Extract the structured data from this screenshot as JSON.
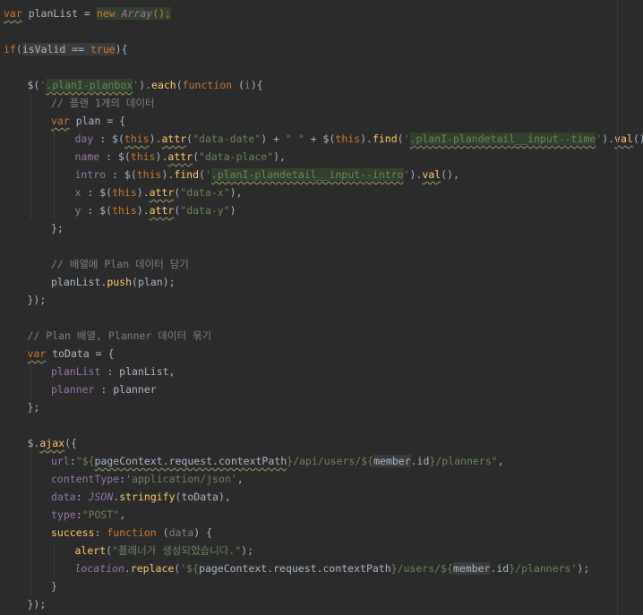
{
  "editor": {
    "lines": [
      {
        "n": 1,
        "indent": 0,
        "tokens": [
          {
            "t": "var",
            "c": "kw sq"
          },
          {
            "t": " planList = ",
            "c": "plain"
          },
          {
            "t": "new ",
            "c": "kw hl"
          },
          {
            "t": "Array",
            "c": "prop it hl"
          },
          {
            "t": "();",
            "c": "kw hl"
          }
        ]
      },
      {
        "n": 2,
        "indent": 0,
        "tokens": []
      },
      {
        "n": 3,
        "indent": 0,
        "tokens": [
          {
            "t": "if",
            "c": "kw"
          },
          {
            "t": "(",
            "c": "plain"
          },
          {
            "t": "isValid == ",
            "c": "plain hl2"
          },
          {
            "t": "true",
            "c": "kw hl2"
          },
          {
            "t": "){",
            "c": "plain"
          }
        ]
      },
      {
        "n": 4,
        "indent": 0,
        "tokens": []
      },
      {
        "n": 5,
        "indent": 1,
        "tokens": [
          {
            "t": "$(",
            "c": "plain"
          },
          {
            "t": "'",
            "c": "str"
          },
          {
            "t": ".planI-planbox",
            "c": "str hl sq"
          },
          {
            "t": "'",
            "c": "str"
          },
          {
            "t": ").",
            "c": "plain"
          },
          {
            "t": "each",
            "c": "fn"
          },
          {
            "t": "(",
            "c": "plain"
          },
          {
            "t": "function ",
            "c": "kw"
          },
          {
            "t": "(",
            "c": "plain"
          },
          {
            "t": "i",
            "c": "cmt"
          },
          {
            "t": "){",
            "c": "plain"
          }
        ]
      },
      {
        "n": 6,
        "indent": 2,
        "tokens": [
          {
            "t": "// 플랜 1개의 데이터",
            "c": "cmt"
          }
        ]
      },
      {
        "n": 7,
        "indent": 2,
        "tokens": [
          {
            "t": "var",
            "c": "kw sq"
          },
          {
            "t": " plan = {",
            "c": "plain"
          }
        ]
      },
      {
        "n": 8,
        "indent": 3,
        "tokens": [
          {
            "t": "day",
            "c": "prop"
          },
          {
            "t": " : $(",
            "c": "plain"
          },
          {
            "t": "this",
            "c": "kw sq"
          },
          {
            "t": ").",
            "c": "plain"
          },
          {
            "t": "attr",
            "c": "fn sq"
          },
          {
            "t": "(",
            "c": "plain"
          },
          {
            "t": "\"data-date\"",
            "c": "str"
          },
          {
            "t": ") + ",
            "c": "plain"
          },
          {
            "t": "\" \"",
            "c": "str"
          },
          {
            "t": " + $(",
            "c": "plain"
          },
          {
            "t": "this",
            "c": "kw"
          },
          {
            "t": ").",
            "c": "plain"
          },
          {
            "t": "find",
            "c": "fn"
          },
          {
            "t": "(",
            "c": "plain"
          },
          {
            "t": "'",
            "c": "str"
          },
          {
            "t": ".planI-plandetail__input--time",
            "c": "str hl sq"
          },
          {
            "t": "'",
            "c": "str"
          },
          {
            "t": ").",
            "c": "plain"
          },
          {
            "t": "val",
            "c": "fn sq"
          },
          {
            "t": "(),",
            "c": "plain"
          }
        ]
      },
      {
        "n": 9,
        "indent": 3,
        "tokens": [
          {
            "t": "name",
            "c": "prop"
          },
          {
            "t": " : $(",
            "c": "plain"
          },
          {
            "t": "this",
            "c": "kw"
          },
          {
            "t": ").",
            "c": "plain"
          },
          {
            "t": "attr",
            "c": "fn sq"
          },
          {
            "t": "(",
            "c": "plain"
          },
          {
            "t": "\"data-place\"",
            "c": "str"
          },
          {
            "t": "),",
            "c": "plain"
          }
        ]
      },
      {
        "n": 10,
        "indent": 3,
        "tokens": [
          {
            "t": "intro",
            "c": "prop"
          },
          {
            "t": " : $(",
            "c": "plain"
          },
          {
            "t": "this",
            "c": "kw"
          },
          {
            "t": ").",
            "c": "plain"
          },
          {
            "t": "find",
            "c": "fn"
          },
          {
            "t": "(",
            "c": "plain"
          },
          {
            "t": "'",
            "c": "str"
          },
          {
            "t": ".planI-plandetail__input--intro",
            "c": "str hl sq"
          },
          {
            "t": "'",
            "c": "str"
          },
          {
            "t": ").",
            "c": "plain"
          },
          {
            "t": "val",
            "c": "fn sq"
          },
          {
            "t": "(),",
            "c": "plain"
          }
        ]
      },
      {
        "n": 11,
        "indent": 3,
        "tokens": [
          {
            "t": "x",
            "c": "prop"
          },
          {
            "t": " : $(",
            "c": "plain"
          },
          {
            "t": "this",
            "c": "kw"
          },
          {
            "t": ").",
            "c": "plain"
          },
          {
            "t": "attr",
            "c": "fn sq"
          },
          {
            "t": "(",
            "c": "plain"
          },
          {
            "t": "\"data-x\"",
            "c": "str"
          },
          {
            "t": "),",
            "c": "plain"
          }
        ]
      },
      {
        "n": 12,
        "indent": 3,
        "tokens": [
          {
            "t": "y",
            "c": "prop"
          },
          {
            "t": " : $(",
            "c": "plain"
          },
          {
            "t": "this",
            "c": "kw"
          },
          {
            "t": ").",
            "c": "plain"
          },
          {
            "t": "attr",
            "c": "fn sq"
          },
          {
            "t": "(",
            "c": "plain"
          },
          {
            "t": "\"data-y\"",
            "c": "str"
          },
          {
            "t": ")",
            "c": "plain"
          }
        ]
      },
      {
        "n": 13,
        "indent": 2,
        "tokens": [
          {
            "t": "};",
            "c": "plain"
          }
        ]
      },
      {
        "n": 14,
        "indent": 0,
        "tokens": []
      },
      {
        "n": 15,
        "indent": 2,
        "tokens": [
          {
            "t": "// 배열에 Plan 데이터 담기",
            "c": "cmt"
          }
        ]
      },
      {
        "n": 16,
        "indent": 2,
        "tokens": [
          {
            "t": "planList",
            "c": "plain"
          },
          {
            "t": ".",
            "c": "plain"
          },
          {
            "t": "push",
            "c": "fn"
          },
          {
            "t": "(plan);",
            "c": "plain"
          }
        ]
      },
      {
        "n": 17,
        "indent": 1,
        "tokens": [
          {
            "t": "});",
            "c": "plain"
          }
        ]
      },
      {
        "n": 18,
        "indent": 0,
        "tokens": []
      },
      {
        "n": 19,
        "indent": 1,
        "tokens": [
          {
            "t": "// Plan 배열, Planner 데이터 묶기",
            "c": "cmt"
          }
        ]
      },
      {
        "n": 20,
        "indent": 1,
        "tokens": [
          {
            "t": "var",
            "c": "kw sq"
          },
          {
            "t": " toData = {",
            "c": "plain"
          }
        ]
      },
      {
        "n": 21,
        "indent": 2,
        "tokens": [
          {
            "t": "planList",
            "c": "prop"
          },
          {
            "t": " : planList,",
            "c": "plain"
          }
        ]
      },
      {
        "n": 22,
        "indent": 2,
        "tokens": [
          {
            "t": "planner",
            "c": "prop"
          },
          {
            "t": " : planner",
            "c": "plain"
          }
        ]
      },
      {
        "n": 23,
        "indent": 1,
        "tokens": [
          {
            "t": "};",
            "c": "plain"
          }
        ]
      },
      {
        "n": 24,
        "indent": 0,
        "tokens": []
      },
      {
        "n": 25,
        "indent": 1,
        "tokens": [
          {
            "t": "$.",
            "c": "plain"
          },
          {
            "t": "ajax",
            "c": "fn sq"
          },
          {
            "t": "({",
            "c": "plain"
          }
        ]
      },
      {
        "n": 26,
        "indent": 2,
        "tokens": [
          {
            "t": "url",
            "c": "prop"
          },
          {
            "t": ":",
            "c": "plain"
          },
          {
            "t": "\"${",
            "c": "str"
          },
          {
            "t": "pageContext.request.contextPath",
            "c": "plain sq"
          },
          {
            "t": "}/api/users/${",
            "c": "str"
          },
          {
            "t": "member",
            "c": "plain hl2"
          },
          {
            "t": ".id",
            "c": "plain"
          },
          {
            "t": "}/planners\"",
            "c": "str"
          },
          {
            "t": ",",
            "c": "plain"
          }
        ]
      },
      {
        "n": 27,
        "indent": 2,
        "tokens": [
          {
            "t": "contentType",
            "c": "prop"
          },
          {
            "t": ":",
            "c": "plain"
          },
          {
            "t": "'application/json'",
            "c": "str"
          },
          {
            "t": ",",
            "c": "plain"
          }
        ]
      },
      {
        "n": 28,
        "indent": 2,
        "tokens": [
          {
            "t": "data",
            "c": "prop"
          },
          {
            "t": ": ",
            "c": "plain"
          },
          {
            "t": "JSON",
            "c": "prop it"
          },
          {
            "t": ".",
            "c": "plain"
          },
          {
            "t": "stringify",
            "c": "fn"
          },
          {
            "t": "(toData),",
            "c": "plain"
          }
        ]
      },
      {
        "n": 29,
        "indent": 2,
        "tokens": [
          {
            "t": "type",
            "c": "prop"
          },
          {
            "t": ":",
            "c": "plain"
          },
          {
            "t": "\"POST\"",
            "c": "str"
          },
          {
            "t": ",",
            "c": "plain"
          }
        ]
      },
      {
        "n": 30,
        "indent": 2,
        "tokens": [
          {
            "t": "success",
            "c": "fn"
          },
          {
            "t": ": ",
            "c": "plain"
          },
          {
            "t": "function ",
            "c": "kw"
          },
          {
            "t": "(",
            "c": "plain"
          },
          {
            "t": "data",
            "c": "cmt"
          },
          {
            "t": ") {",
            "c": "plain"
          }
        ]
      },
      {
        "n": 31,
        "indent": 3,
        "tokens": [
          {
            "t": "alert",
            "c": "fn"
          },
          {
            "t": "(",
            "c": "plain"
          },
          {
            "t": "\"플래너가 생성되었습니다.\"",
            "c": "str"
          },
          {
            "t": ");",
            "c": "plain"
          }
        ]
      },
      {
        "n": 32,
        "indent": 3,
        "tokens": [
          {
            "t": "location",
            "c": "prop it"
          },
          {
            "t": ".",
            "c": "plain"
          },
          {
            "t": "replace",
            "c": "fn"
          },
          {
            "t": "(",
            "c": "plain"
          },
          {
            "t": "'${",
            "c": "str"
          },
          {
            "t": "pageContext.request.contextPath",
            "c": "plain"
          },
          {
            "t": "}/users/${",
            "c": "str"
          },
          {
            "t": "member",
            "c": "plain hl2"
          },
          {
            "t": ".id",
            "c": "plain"
          },
          {
            "t": "}/planners'",
            "c": "str"
          },
          {
            "t": ");",
            "c": "plain"
          }
        ]
      },
      {
        "n": 33,
        "indent": 2,
        "tokens": [
          {
            "t": "}",
            "c": "plain"
          }
        ]
      },
      {
        "n": 34,
        "indent": 1,
        "tokens": [
          {
            "t": "});",
            "c": "plain"
          }
        ]
      }
    ]
  },
  "colors": {
    "background": "#2b2b2b",
    "keyword": "#cc7832",
    "string": "#6a8759",
    "comment": "#808080",
    "function": "#ffc66d",
    "property": "#9876aa",
    "text": "#a9b7c6"
  }
}
